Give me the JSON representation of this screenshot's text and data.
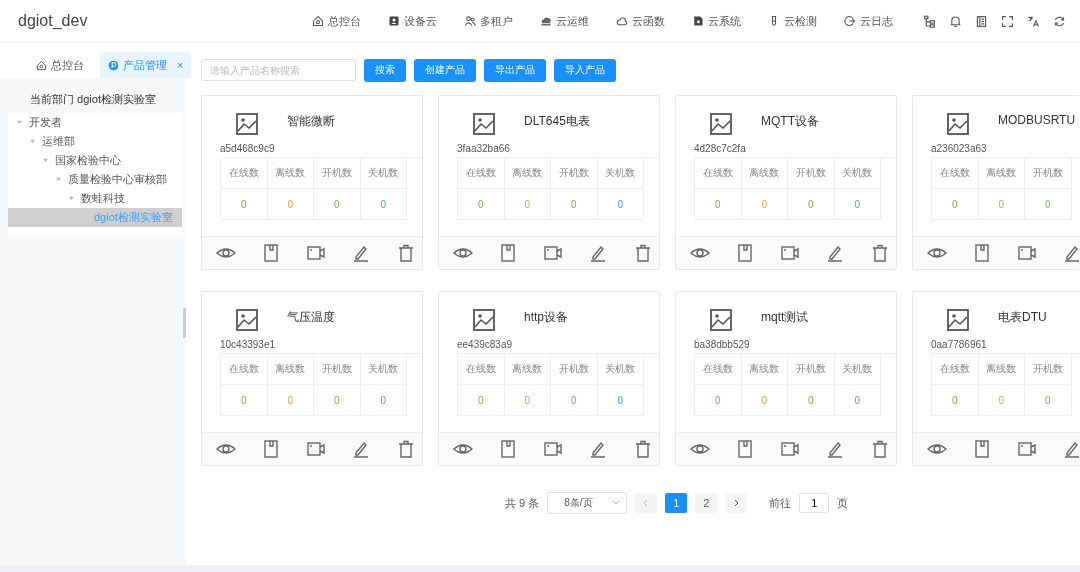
{
  "header": {
    "logo": "dgiot_dev",
    "nav": [
      {
        "label": "总控台"
      },
      {
        "label": "设备云"
      },
      {
        "label": "多租户"
      },
      {
        "label": "云运维"
      },
      {
        "label": "云函数"
      },
      {
        "label": "云系统"
      },
      {
        "label": "云检测"
      },
      {
        "label": "云日志"
      }
    ]
  },
  "tabs": [
    {
      "label": "总控台",
      "selected": false
    },
    {
      "label": "产品管理",
      "selected": true,
      "close": "×"
    }
  ],
  "sidebar": {
    "department": "当前部门 dgiot检测实验室",
    "tree": [
      {
        "label": "开发者",
        "expanded": true,
        "selected": false,
        "children": [
          {
            "label": "运维部",
            "expanded": true,
            "selected": false,
            "children": [
              {
                "label": "国家检验中心",
                "expanded": true,
                "selected": false,
                "children": [
                  {
                    "label": "质量检验中心审核部",
                    "expanded": true,
                    "selected": false,
                    "children": [
                      {
                        "label": "数蛙科技",
                        "expanded": true,
                        "selected": false,
                        "children": [
                          {
                            "label": "dgiot检测实验室",
                            "selected": true
                          }
                        ]
                      }
                    ]
                  }
                ]
              }
            ]
          }
        ]
      }
    ]
  },
  "toolbar": {
    "search": {
      "placeholder": "请输入产品名称搜索"
    },
    "buttons": [
      "搜索",
      "创建产品",
      "导出产品",
      "导入产品"
    ]
  },
  "products": [
    {
      "name": "智能微断",
      "id": "a5d468c9c9",
      "stats": [
        {
          "label": "在线数",
          "value": "0",
          "kind": "online"
        },
        {
          "label": "离线数",
          "value": "0",
          "kind": "offline"
        },
        {
          "label": "开机数",
          "value": "0",
          "kind": "on"
        },
        {
          "label": "关机数",
          "value": "0",
          "kind": "off"
        }
      ]
    },
    {
      "name": "DLT645电表",
      "id": "3faa32ba66",
      "stats": [
        {
          "label": "在线数",
          "value": "0",
          "kind": "online"
        },
        {
          "label": "离线数",
          "value": "0",
          "kind": "offline"
        },
        {
          "label": "开机数",
          "value": "0",
          "kind": "on"
        },
        {
          "label": "关机数",
          "value": "0",
          "kind": "off"
        }
      ]
    },
    {
      "name": "MQTT设备",
      "id": "4d28c7c2fa",
      "stats": [
        {
          "label": "在线数",
          "value": "0",
          "kind": "online"
        },
        {
          "label": "离线数",
          "value": "0",
          "kind": "offline"
        },
        {
          "label": "开机数",
          "value": "0",
          "kind": "on"
        },
        {
          "label": "关机数",
          "value": "0",
          "kind": "off"
        }
      ]
    },
    {
      "name": "MODBUSRTU",
      "id": "a236023a63",
      "stats": [
        {
          "label": "在线数",
          "value": "0",
          "kind": "online"
        },
        {
          "label": "离线数",
          "value": "0",
          "kind": "offline"
        },
        {
          "label": "开机数",
          "value": "0",
          "kind": "on"
        }
      ]
    },
    {
      "name": "气压温度",
      "id": "10c43393e1",
      "stats": [
        {
          "label": "在线数",
          "value": "0",
          "kind": "online"
        },
        {
          "label": "离线数",
          "value": "0",
          "kind": "offline"
        },
        {
          "label": "开机数",
          "value": "0",
          "kind": "on"
        },
        {
          "label": "关机数",
          "value": "0",
          "kind": "off"
        }
      ]
    },
    {
      "name": "http设备",
      "id": "ee439c83a9",
      "stats": [
        {
          "label": "在线数",
          "value": "0",
          "kind": "online"
        },
        {
          "label": "离线数",
          "value": "0",
          "kind": "offline"
        },
        {
          "label": "开机数",
          "value": "0",
          "kind": "on"
        },
        {
          "label": "关机数",
          "value": "0",
          "kind": "off"
        }
      ]
    },
    {
      "name": "mqtt测试",
      "id": "ba38dbb529",
      "stats": [
        {
          "label": "在线数",
          "value": "0",
          "kind": "online"
        },
        {
          "label": "离线数",
          "value": "0",
          "kind": "offline"
        },
        {
          "label": "开机数",
          "value": "0",
          "kind": "on"
        },
        {
          "label": "关机数",
          "value": "0",
          "kind": "off"
        }
      ]
    },
    {
      "name": "电表DTU",
      "id": "0aa7786961",
      "stats": [
        {
          "label": "在线数",
          "value": "0",
          "kind": "online"
        },
        {
          "label": "离线数",
          "value": "0",
          "kind": "offline"
        },
        {
          "label": "开机数",
          "value": "0",
          "kind": "on"
        }
      ]
    }
  ],
  "pagination": {
    "total": "共 9 条",
    "page_size": "8条/页",
    "pages": [
      {
        "label": "1",
        "selected": true
      },
      {
        "label": "2",
        "selected": false
      }
    ],
    "goto_label": "前往",
    "goto_value": "1",
    "page_unit": "页"
  }
}
